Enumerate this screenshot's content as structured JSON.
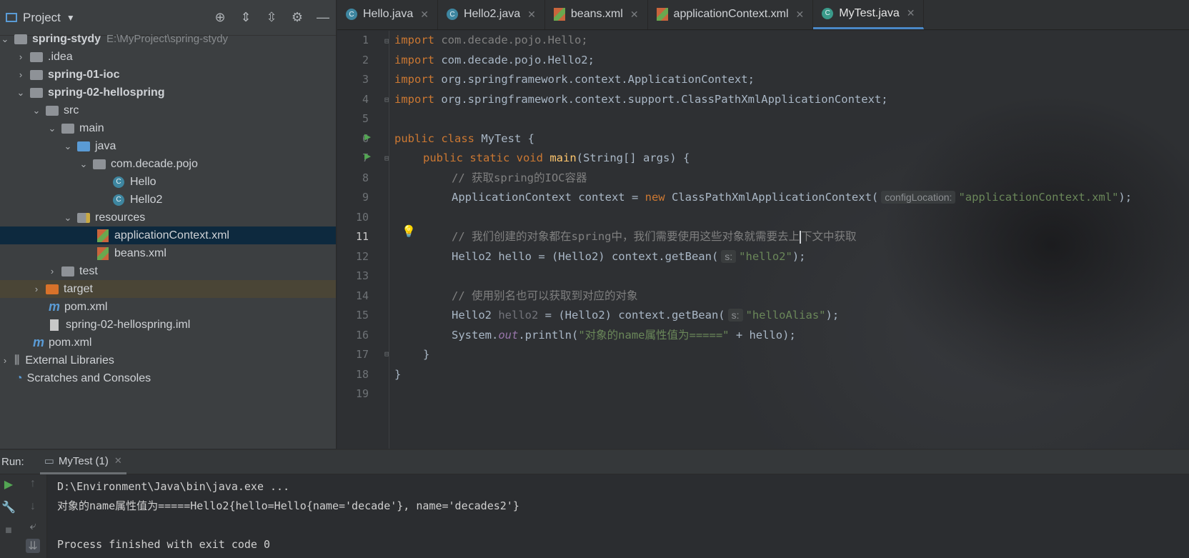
{
  "project": {
    "title": "Project",
    "tree": [
      {
        "label": "spring-stydy",
        "path": "E:\\MyProject\\spring-stydy"
      },
      {
        "label": ".idea"
      },
      {
        "label": "spring-01-ioc"
      },
      {
        "label": "spring-02-hellospring"
      },
      {
        "label": "src"
      },
      {
        "label": "main"
      },
      {
        "label": "java"
      },
      {
        "label": "com.decade.pojo"
      },
      {
        "label": "Hello"
      },
      {
        "label": "Hello2"
      },
      {
        "label": "resources"
      },
      {
        "label": "applicationContext.xml"
      },
      {
        "label": "beans.xml"
      },
      {
        "label": "test"
      },
      {
        "label": "target"
      },
      {
        "label": "pom.xml"
      },
      {
        "label": "spring-02-hellospring.iml"
      },
      {
        "label": "pom.xml"
      },
      {
        "label": "External Libraries"
      },
      {
        "label": "Scratches and Consoles"
      }
    ]
  },
  "tabs": [
    "Hello.java",
    "Hello2.java",
    "beans.xml",
    "applicationContext.xml",
    "MyTest.java"
  ],
  "editor": {
    "line_numbers": [
      "1",
      "2",
      "3",
      "4",
      "5",
      "6",
      "7",
      "8",
      "9",
      "10",
      "11",
      "12",
      "13",
      "14",
      "15",
      "16",
      "17",
      "18",
      "19"
    ],
    "lines": {
      "l1_kw": "import",
      "l1_rest": " com.decade.pojo.Hello;",
      "l2_kw": "import",
      "l2_rest": " com.decade.pojo.Hello2;",
      "l3_kw": "import",
      "l3_rest": " org.springframework.context.ApplicationContext;",
      "l4_kw": "import",
      "l4_rest": " org.springframework.context.support.ClassPathXmlApplicationContext;",
      "l6_kw": "public class",
      "l6_rest": " MyTest {",
      "l7_kw": "public static void",
      "l7_mth": "main",
      "l7_rest": "(String[] args) {",
      "l8": "// 获取spring的IOC容器",
      "l9_a": "ApplicationContext context = ",
      "l9_kw": "new",
      "l9_b": " ClassPathXmlApplicationContext(",
      "l9_hint": "configLocation:",
      "l9_str": "\"applicationContext.xml\"",
      "l9_end": ");",
      "l11_a": "// 我们创建的对象都在spring中，我们需要使用这些对象就需要去上",
      "l11_b": "下文中获取",
      "l12_a": "Hello2 hello = (Hello2) context.getBean(",
      "l12_hint": "s:",
      "l12_str": "\"hello2\"",
      "l12_end": ");",
      "l14": "// 使用别名也可以获取到对应的对象",
      "l15_a": "Hello2 ",
      "l15_var": "hello2",
      "l15_b": " = (Hello2) context.getBean(",
      "l15_hint": "s:",
      "l15_str": "\"helloAlias\"",
      "l15_end": ");",
      "l16_a": "System.",
      "l16_fld": "out",
      "l16_b": ".println(",
      "l16_str": "\"对象的name属性值为=====\"",
      "l16_c": " + hello);",
      "l17": "}",
      "l18": "}"
    }
  },
  "run": {
    "label": "Run:",
    "tab": "MyTest (1)",
    "console": [
      "D:\\Environment\\Java\\bin\\java.exe ...",
      "对象的name属性值为=====Hello2{hello=Hello{name='decade'}, name='decades2'}",
      "",
      "Process finished with exit code 0"
    ]
  }
}
